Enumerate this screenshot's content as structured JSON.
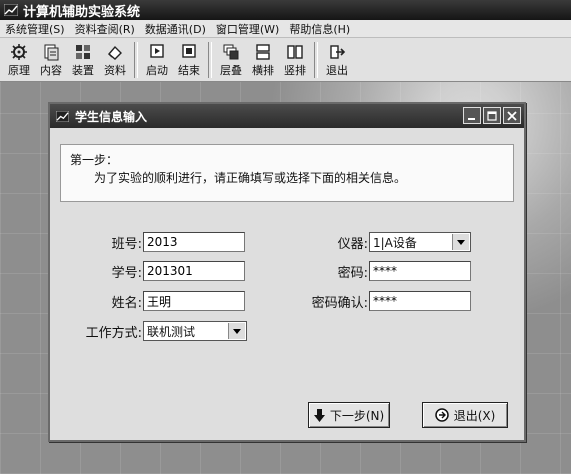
{
  "app": {
    "title": "计算机辅助实验系统"
  },
  "menu": [
    "系统管理(S)",
    "资料查阅(R)",
    "数据通讯(D)",
    "窗口管理(W)",
    "帮助信息(H)"
  ],
  "toolbar": {
    "group1": [
      "原理",
      "内容",
      "装置",
      "资料"
    ],
    "group2": [
      "启动",
      "结束"
    ],
    "group3": [
      "层叠",
      "横排",
      "竖排"
    ],
    "group4": [
      "退出"
    ]
  },
  "dialog": {
    "title": "学生信息输入",
    "step_title": "第一步：",
    "step_text": "为了实验的顺利进行，请正确填写或选择下面的相关信息。",
    "fields": {
      "class_label": "班号:",
      "class_value": "2013",
      "student_id_label": "学号:",
      "student_id_value": "201301",
      "name_label": "姓名:",
      "name_value": "王明",
      "mode_label": "工作方式:",
      "mode_value": "联机测试",
      "instrument_label": "仪器:",
      "instrument_value": "1|A设备",
      "password_label": "密码:",
      "password_value": "****",
      "confirm_label": "密码确认:",
      "confirm_value": "****"
    },
    "next_button": "下一步(N)",
    "exit_button": "退出(X)"
  }
}
